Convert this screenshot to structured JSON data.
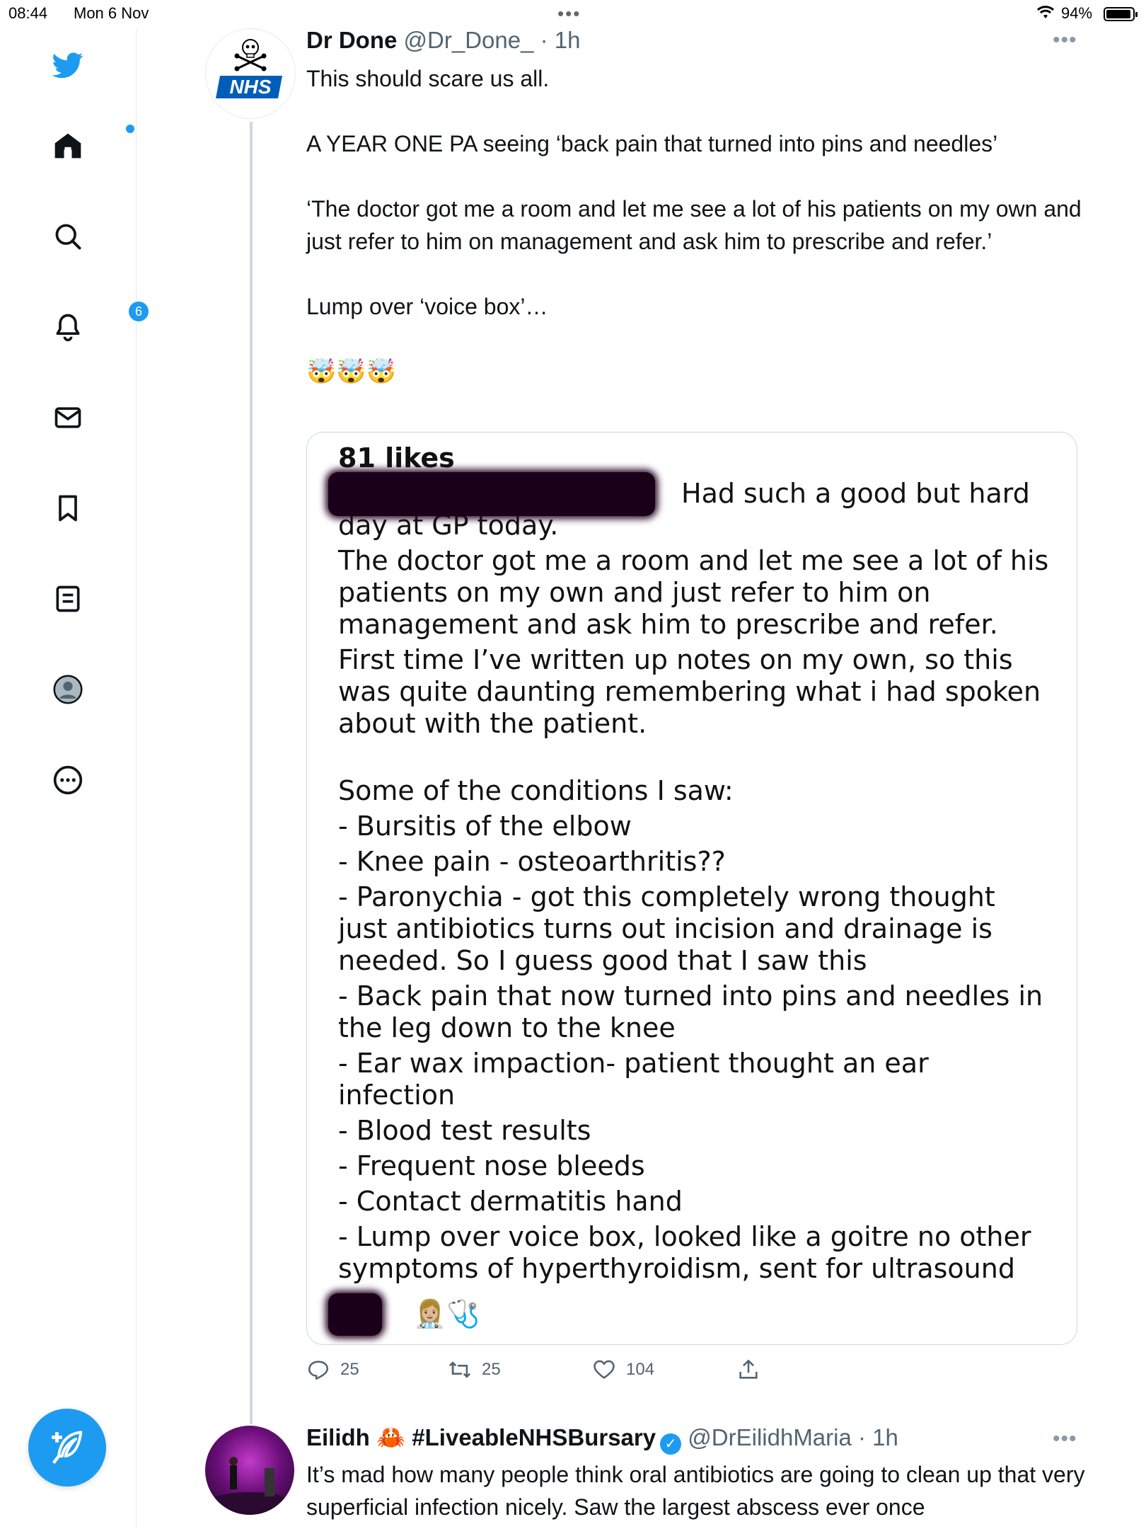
{
  "status_bar": {
    "time": "08:44",
    "date": "Mon 6 Nov",
    "battery_pct": "94%",
    "battery_level": 0.94
  },
  "sidebar": {
    "items": [
      {
        "name": "twitter-logo",
        "icon": "bird-icon"
      },
      {
        "name": "home",
        "icon": "home-icon"
      },
      {
        "name": "explore",
        "icon": "search-icon"
      },
      {
        "name": "notifications",
        "icon": "bell-icon",
        "badge": "6"
      },
      {
        "name": "messages",
        "icon": "mail-icon"
      },
      {
        "name": "bookmarks",
        "icon": "bookmark-icon"
      },
      {
        "name": "lists",
        "icon": "list-icon"
      },
      {
        "name": "profile",
        "icon": "profile-icon"
      },
      {
        "name": "more",
        "icon": "more-circle-icon"
      }
    ],
    "compose_icon": "feather-plus-icon"
  },
  "tweet1": {
    "author_name": "Dr Done",
    "handle_time": "@Dr_Done_ · 1h",
    "avatar_text": "NHS",
    "paragraphs": [
      "This should scare us all.",
      "A YEAR ONE PA seeing ‘back pain that turned into pins and needles’",
      "‘The doctor got me a room and let me see a lot of his patients on my own and just refer to him on management and ask him to prescribe and refer.’",
      "Lump over ‘voice box’…",
      "🤯🤯🤯"
    ],
    "quote": {
      "likes": "81 likes",
      "intro": "Had such a good but hard day at GP today.",
      "p1": "The doctor got me a room and let me see a lot of his patients on my own and just refer to him on management and ask him to prescribe and refer.",
      "p2": "First time I’ve written up notes on my own, so this was quite daunting remembering what i had spoken about with the patient.",
      "conditions_header": "Some of the conditions I saw:",
      "conditions": [
        "- Bursitis of the elbow",
        "- Knee pain - osteoarthritis??",
        "- Paronychia - got this completely wrong thought just antibiotics turns out incision and drainage is needed. So I guess good that I saw this",
        "- Back pain that now turned into pins and needles in the leg down to the knee",
        "- Ear wax impaction- patient thought an ear infection",
        "-  Blood test results",
        "- Frequent nose bleeds",
        "- Contact dermatitis hand",
        "- Lump over voice box, looked like a goitre no other symptoms of hyperthyroidism, sent for ultrasound"
      ],
      "signature_emoji": "👩🏼‍⚕️🩺"
    },
    "actions": {
      "replies": "25",
      "retweets": "25",
      "likes": "104"
    }
  },
  "tweet2": {
    "author_name": "Eilidh",
    "crab": "🦀",
    "hashtag": "#LiveableNHSBursary",
    "handle_time": "@DrEilidhMaria · 1h",
    "text": "It’s mad how many people think oral antibiotics are going to clean up that very superficial infection nicely. Saw the largest abscess ever once"
  },
  "colors": {
    "accent": "#1d9bf0",
    "text": "#0f1419",
    "muted": "#536471",
    "border": "#cfd9de"
  }
}
